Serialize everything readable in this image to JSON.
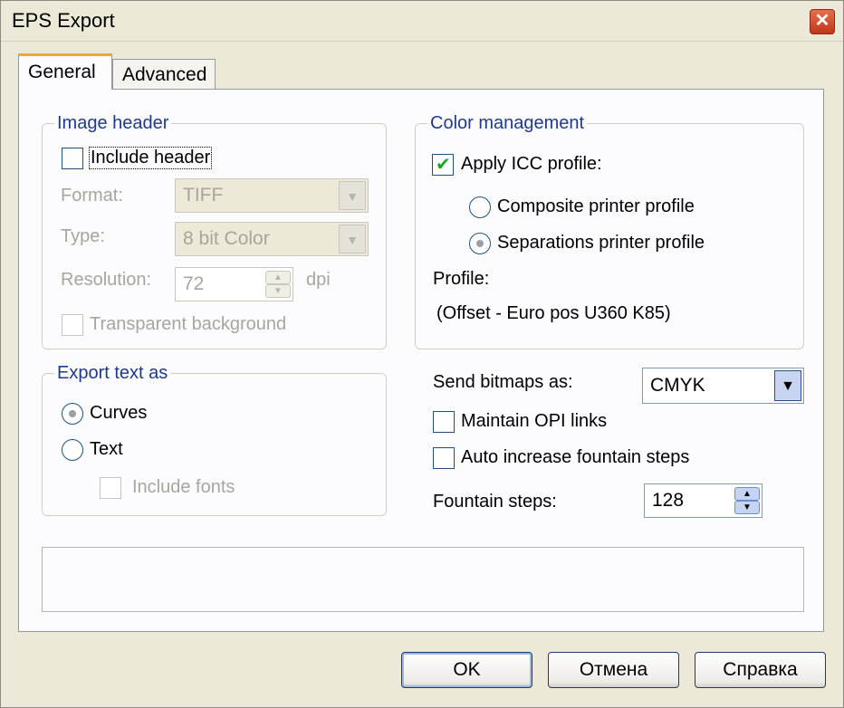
{
  "window": {
    "title": "EPS Export",
    "close_icon": "close-icon"
  },
  "tabs": [
    {
      "label": "General",
      "active": true
    },
    {
      "label": "Advanced",
      "active": false
    }
  ],
  "image_header": {
    "legend": "Image header",
    "include_header": {
      "label": "Include header",
      "checked": false
    },
    "format": {
      "label": "Format:",
      "value": "TIFF"
    },
    "type": {
      "label": "Type:",
      "value": "8 bit Color"
    },
    "resolution": {
      "label": "Resolution:",
      "value": "72",
      "unit": "dpi"
    },
    "transparent_background": {
      "label": "Transparent background",
      "checked": false
    }
  },
  "export_text": {
    "legend": "Export text as",
    "curves": {
      "label": "Curves",
      "selected": true
    },
    "text": {
      "label": "Text",
      "selected": false
    },
    "include_fonts": {
      "label": "Include fonts",
      "checked": false
    }
  },
  "color_management": {
    "legend": "Color management",
    "apply_icc": {
      "label": "Apply ICC profile:",
      "checked": true
    },
    "composite": {
      "label": "Composite printer profile",
      "selected": false
    },
    "separations": {
      "label": "Separations printer profile",
      "selected": true
    },
    "profile_label": "Profile:",
    "profile_value": "(Offset - Euro pos U360 K85)"
  },
  "bitmaps": {
    "label": "Send bitmaps as:",
    "value": "CMYK"
  },
  "maintain_opi": {
    "label": "Maintain OPI links",
    "checked": false
  },
  "auto_fountain": {
    "label": "Auto increase fountain steps",
    "checked": false
  },
  "fountain_steps": {
    "label": "Fountain steps:",
    "value": "128"
  },
  "buttons": {
    "ok": "OK",
    "cancel": "Отмена",
    "help": "Справка"
  },
  "colors": {
    "face": "#ece9d8",
    "legend": "#1e3a8a",
    "check": "#21a121",
    "disabled_text": "#a7a69c"
  }
}
